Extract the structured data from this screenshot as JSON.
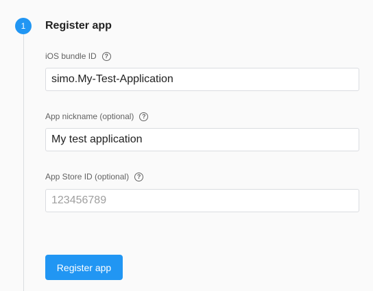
{
  "step": {
    "number": "1",
    "title": "Register app"
  },
  "fields": [
    {
      "label": "iOS bundle ID",
      "value": "simo.My-Test-Application",
      "placeholder": ""
    },
    {
      "label": "App nickname (optional)",
      "value": "My test application",
      "placeholder": ""
    },
    {
      "label": "App Store ID (optional)",
      "value": "",
      "placeholder": "123456789"
    }
  ],
  "help_icon_glyph": "?",
  "icons": [
    "help-icon"
  ],
  "submit_label": "Register app",
  "colors": {
    "accent": "#2196f3",
    "background": "#fafafa",
    "border": "#dadce0",
    "label": "#616161",
    "text": "#212121",
    "placeholder": "#9e9e9e"
  }
}
